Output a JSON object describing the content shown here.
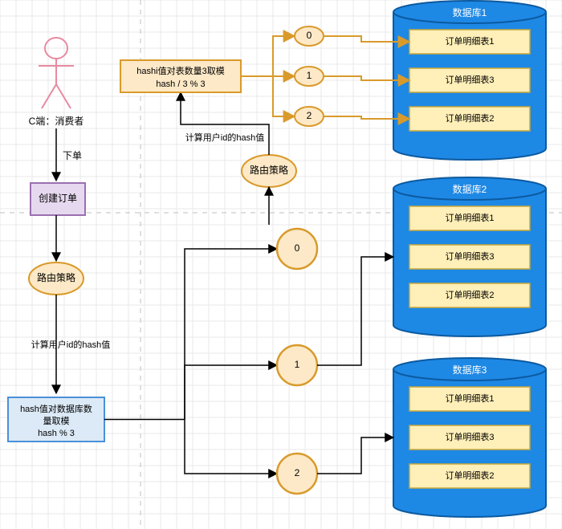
{
  "actor": {
    "label": "C端：消费者"
  },
  "edges": {
    "place_order": "下单",
    "hash_user_top": "计算用户id的hash值",
    "hash_user_left": "计算用户id的hash值"
  },
  "nodes": {
    "create_order": "创建订单",
    "route_strategy_left": "路由策略",
    "route_strategy_top": "路由策略",
    "db_mod": {
      "line1": "hash值对数据库数",
      "line2": "量取模",
      "line3": "hash % 3"
    },
    "table_mod": {
      "line1": "hashi值对表数量3取模",
      "line2": "hash / 3 % 3"
    },
    "mod_results_db": [
      "0",
      "1",
      "2"
    ],
    "mod_results_table": [
      "0",
      "1",
      "2"
    ]
  },
  "databases": [
    {
      "title": "数据库1",
      "tables": [
        "订单明细表1",
        "订单明细表3",
        "订单明细表2"
      ]
    },
    {
      "title": "数据库2",
      "tables": [
        "订单明细表1",
        "订单明细表3",
        "订单明细表2"
      ]
    },
    {
      "title": "数据库3",
      "tables": [
        "订单明细表1",
        "订单明细表3",
        "订单明细表2"
      ]
    }
  ],
  "colors": {
    "grid": "#e8e8e8",
    "grid_dash": "#bfbfbf",
    "actor": "#e88aa0",
    "orange_stroke": "#d99a2b",
    "orange_fill": "#fde9c7",
    "purple_stroke": "#9a6fb0",
    "purple_fill": "#e6d9ef",
    "blue_stroke": "#1e88e5",
    "blue_fill": "#1e88e5",
    "lightblue_stroke": "#4a90d9",
    "lightblue_fill": "#dceaf7",
    "yellow_fill": "#ffefb8",
    "yellow_stroke": "#c9a83a"
  }
}
